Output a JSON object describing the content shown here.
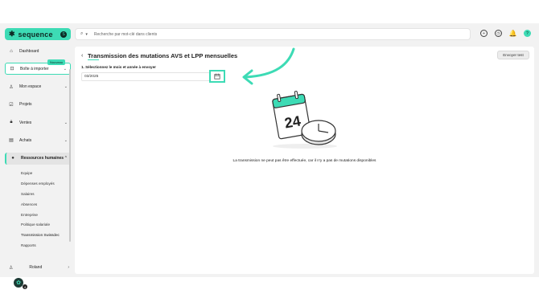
{
  "brand": {
    "name": "sequence",
    "badge": "S"
  },
  "search": {
    "placeholder": "Recherche par mot-clé dans clients"
  },
  "sidebar": {
    "items": [
      {
        "label": "Dashboard",
        "icon": "home-icon"
      },
      {
        "label": "Boîte à importer",
        "icon": "inbox-icon",
        "badge": "Nouveau"
      },
      {
        "label": "Mon espace",
        "icon": "user-icon"
      },
      {
        "label": "Projets",
        "icon": "check-icon"
      },
      {
        "label": "Ventes",
        "icon": "lock-icon"
      },
      {
        "label": "Achats",
        "icon": "cart-icon"
      },
      {
        "label": "Ressources humaines",
        "icon": "people-icon"
      }
    ],
    "sub_items": [
      "Equipe",
      "Dépenses employés",
      "Salaires",
      "Absences",
      "Entreprise",
      "Politique salariale",
      "Transmission Swissdec",
      "Rapports"
    ],
    "user": {
      "name": "Roland"
    },
    "help_count": "4"
  },
  "main": {
    "title": "Transmission des mutations AVS et LPP mensuelles",
    "send_button": "Envoyer test",
    "field_label": "1. Sélectionnez le mois et année à envoyer",
    "date_value": "03/2025",
    "empty_message": "La transmission ne peut pas être effectuée, car il n'y a pas de mutations disponibles",
    "calendar_day": "24"
  },
  "colors": {
    "accent": "#3ddbb5",
    "dark": "#0e2a24"
  }
}
